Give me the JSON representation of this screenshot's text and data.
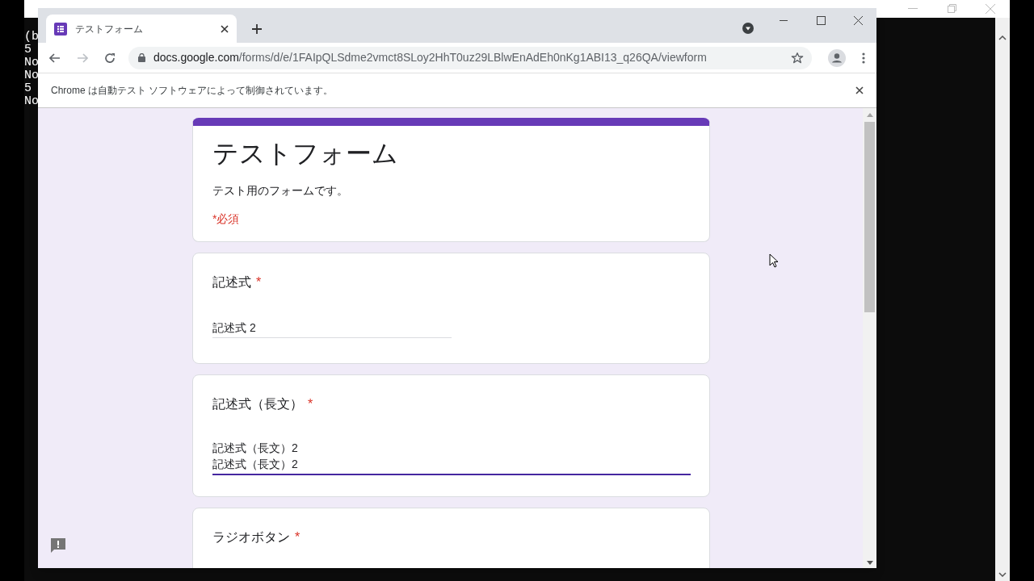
{
  "console": {
    "lines": [
      "(b",
      "5",
      "No",
      "No",
      "5",
      "No"
    ]
  },
  "browser": {
    "tab": {
      "title": "テストフォーム"
    },
    "url": {
      "host": "docs.google.com",
      "path": "/forms/d/e/1FAIpQLSdme2vmct8SLoy2HhT0uz29LBlwEnAdEh0nKg1ABI13_q26QA/viewform"
    },
    "infobar": {
      "message": "Chrome は自動テスト ソフトウェアによって制御されています。"
    }
  },
  "form": {
    "title": "テストフォーム",
    "description": "テスト用のフォームです。",
    "required_note": "*必須",
    "questions": [
      {
        "kind": "short",
        "label": "記述式",
        "required_mark": "*",
        "focused": false,
        "lines": [
          "記述式 2"
        ]
      },
      {
        "kind": "paragraph",
        "label": "記述式（長文）",
        "required_mark": "*",
        "focused": true,
        "lines": [
          "記述式（長文）2",
          "記述式（長文）2"
        ]
      },
      {
        "kind": "radio",
        "label": "ラジオボタン",
        "required_mark": "*"
      }
    ]
  }
}
